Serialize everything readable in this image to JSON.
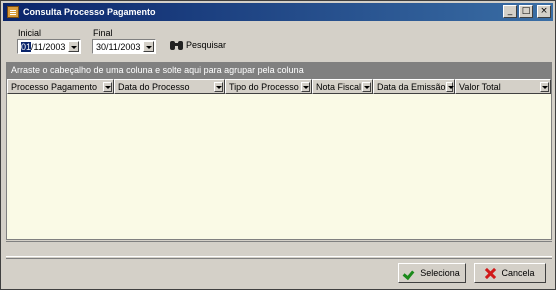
{
  "window": {
    "title": "Consulta Processo Pagamento",
    "controls": {
      "minimize": "_",
      "maximize": "□",
      "close": "×"
    }
  },
  "filters": {
    "initial_label": "Inicial",
    "initial_day": "01",
    "initial_rest": "/11/2003",
    "final_label": "Final",
    "final_value": "30/11/2003",
    "search_label": "Pesquisar",
    "search_icon": "binoculars-icon"
  },
  "grid": {
    "group_hint": "Arraste o cabeçalho de uma coluna e solte aqui para agrupar pela coluna",
    "columns": [
      "Processo Pagamento",
      "Data do Processo",
      "Tipo do Processo",
      "Nota Fiscal",
      "Data da Emissão",
      "Valor Total"
    ],
    "rows": []
  },
  "actions": {
    "select_label": "Seleciona",
    "cancel_label": "Cancela"
  },
  "colors": {
    "title_bar": "#0a246a",
    "grid_background": "#fafae6",
    "group_panel": "#808080",
    "select_icon": "#1b8a1b",
    "cancel_icon": "#d11a1a"
  }
}
